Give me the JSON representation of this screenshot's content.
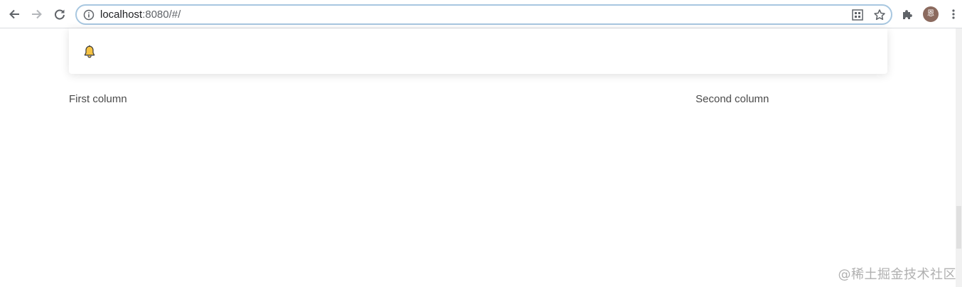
{
  "browser": {
    "url_host": "localhost",
    "url_rest": ":8080/#/",
    "profile_initial": "恩"
  },
  "notification": {
    "icon": "bell-icon",
    "icon_color": "#f6c343"
  },
  "columns": {
    "first_label": "First column",
    "second_label": "Second column"
  },
  "watermark": "@稀土掘金技术社区",
  "colors": {
    "omnibox_border": "#a8c7e0",
    "avatar_bg": "#8b6a5e"
  }
}
